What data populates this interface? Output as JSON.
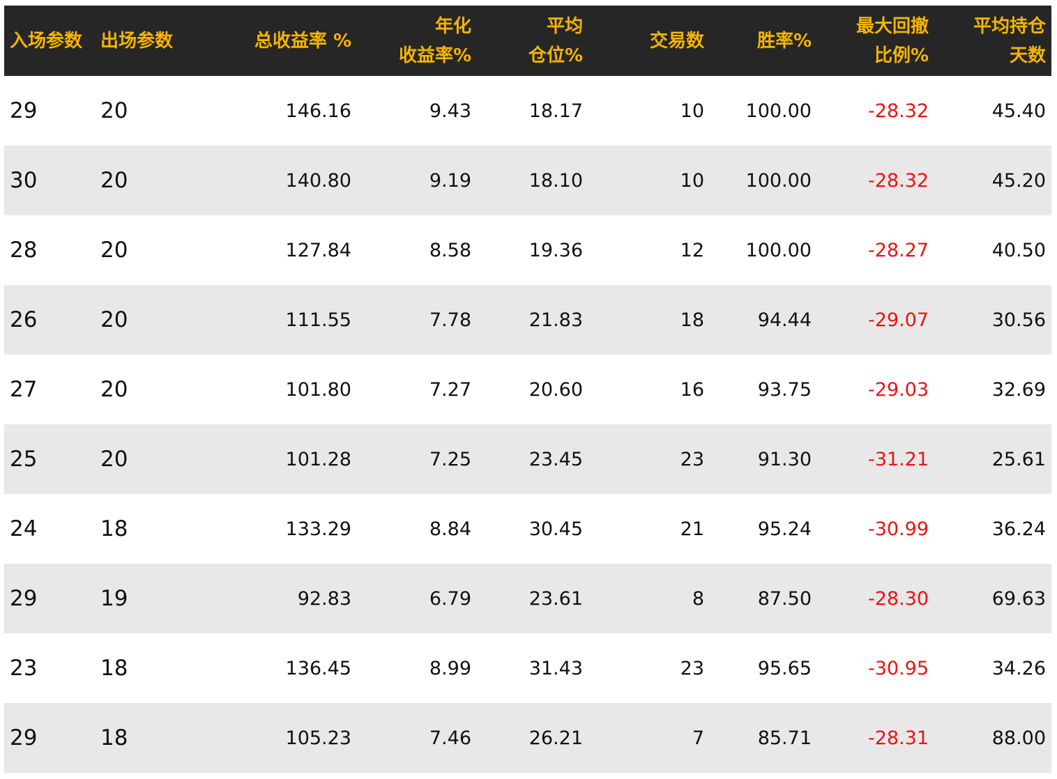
{
  "table": {
    "headers": [
      "入场参数",
      "出场参数",
      "总收益率 %",
      "年化\n收益率%",
      "平均\n仓位%",
      "交易数",
      "胜率%",
      "最大回撤\n比例%",
      "平均持仓\n天数"
    ],
    "rows": [
      [
        "29",
        "20",
        "146.16",
        "9.43",
        "18.17",
        "10",
        "100.00",
        "-28.32",
        "45.40"
      ],
      [
        "30",
        "20",
        "140.80",
        "9.19",
        "18.10",
        "10",
        "100.00",
        "-28.32",
        "45.20"
      ],
      [
        "28",
        "20",
        "127.84",
        "8.58",
        "19.36",
        "12",
        "100.00",
        "-28.27",
        "40.50"
      ],
      [
        "26",
        "20",
        "111.55",
        "7.78",
        "21.83",
        "18",
        "94.44",
        "-29.07",
        "30.56"
      ],
      [
        "27",
        "20",
        "101.80",
        "7.27",
        "20.60",
        "16",
        "93.75",
        "-29.03",
        "32.69"
      ],
      [
        "25",
        "20",
        "101.28",
        "7.25",
        "23.45",
        "23",
        "91.30",
        "-31.21",
        "25.61"
      ],
      [
        "24",
        "18",
        "133.29",
        "8.84",
        "30.45",
        "21",
        "95.24",
        "-30.99",
        "36.24"
      ],
      [
        "29",
        "19",
        "92.83",
        "6.79",
        "23.61",
        "8",
        "87.50",
        "-28.30",
        "69.63"
      ],
      [
        "23",
        "18",
        "136.45",
        "8.99",
        "31.43",
        "23",
        "95.65",
        "-30.95",
        "34.26"
      ],
      [
        "29",
        "18",
        "105.23",
        "7.46",
        "26.21",
        "7",
        "85.71",
        "-28.31",
        "88.00"
      ]
    ]
  },
  "colors": {
    "header_bg": "#262626",
    "header_text": "#f5b400",
    "negative": "#ee1111",
    "stripe": "#e8e8e8"
  }
}
